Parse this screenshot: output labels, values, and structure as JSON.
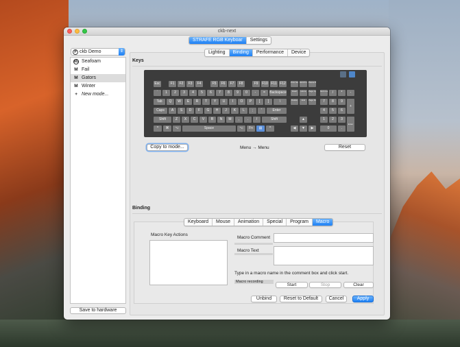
{
  "window": {
    "title": "ckb-next"
  },
  "top_tabs": [
    {
      "label": "STRAFE RGB  Keyboar",
      "active": true
    },
    {
      "label": "Settings",
      "active": false
    }
  ],
  "profile": {
    "icon_letter": "P",
    "name": "ckb Demo"
  },
  "modes": [
    {
      "icon": "M1",
      "label": "Seafoam"
    },
    {
      "icon": "M",
      "label": "Fail"
    },
    {
      "icon": "M",
      "label": "Gators"
    },
    {
      "icon": "M",
      "label": "Winter"
    },
    {
      "icon": "+",
      "label": "New mode..."
    }
  ],
  "save_hardware_label": "Save to hardware",
  "sub_tabs": [
    {
      "label": "Lighting"
    },
    {
      "label": "Binding"
    },
    {
      "label": "Performance"
    },
    {
      "label": "Device"
    }
  ],
  "keys_title": "Keys",
  "keyboard": {
    "fn_row": [
      "Esc",
      "F1",
      "F2",
      "F3",
      "F4",
      "F5",
      "F6",
      "F7",
      "F8",
      "F9",
      "F10",
      "F11",
      "F12"
    ],
    "fn_extra": [
      "Print Screen",
      "Scroll Lock",
      "Pause Break"
    ],
    "num_row": [
      "`",
      "1",
      "2",
      "3",
      "4",
      "5",
      "6",
      "7",
      "8",
      "9",
      "0",
      "-",
      "=",
      "Backspace"
    ],
    "nav_row1": [
      "Insert",
      "Home",
      "Page Up"
    ],
    "numpad_row1": [
      "Num Lock",
      "/",
      "*",
      "-"
    ],
    "q_row": [
      "Tab",
      "Q",
      "W",
      "E",
      "R",
      "T",
      "Y",
      "U",
      "I",
      "O",
      "P",
      "[",
      "]",
      "\\"
    ],
    "nav_row2": [
      "Delete",
      "End",
      "Page Down"
    ],
    "numpad_row2": [
      "7",
      "8",
      "9",
      "+"
    ],
    "a_row": [
      "Caps",
      "A",
      "S",
      "D",
      "F",
      "G",
      "H",
      "J",
      "K",
      "L",
      ";",
      "'",
      "Enter"
    ],
    "numpad_row3": [
      "4",
      "5",
      "6"
    ],
    "z_row": [
      "Shift",
      "Z",
      "X",
      "C",
      "V",
      "B",
      "N",
      "M",
      ",",
      ".",
      "/",
      "Shift"
    ],
    "arrow_up": "▲",
    "numpad_row4": [
      "1",
      "2",
      "3",
      "Enter"
    ],
    "bottom_row": [
      "^",
      "⌘",
      "⌥",
      "Space",
      "⌥",
      "Fn",
      "▤",
      "^"
    ],
    "arrows": [
      "◀",
      "▼",
      "▶"
    ],
    "numpad_row5": [
      "0",
      "."
    ]
  },
  "copy_to_mode_label": "Copy to mode...",
  "mapping_text": "Menu → Menu",
  "reset_label": "Reset",
  "binding_title": "Binding",
  "binding_tabs": [
    {
      "label": "Keyboard"
    },
    {
      "label": "Mouse"
    },
    {
      "label": "Animation"
    },
    {
      "label": "Special"
    },
    {
      "label": "Program"
    },
    {
      "label": "Macro",
      "active": true
    }
  ],
  "macro": {
    "key_actions_label": "Macro Key Actions",
    "comment_label": "Macro Comment",
    "text_label": "Macro Text",
    "hint": "Type in a macro name in the comment box and click start.",
    "recording_label": "Macro recording",
    "start_label": "Start",
    "stop_label": "Stop",
    "clear_label": "Clear"
  },
  "footer": {
    "unbind_label": "Unbind",
    "reset_default_label": "Reset to Default",
    "cancel_label": "Cancel",
    "apply_label": "Apply"
  },
  "colors": {
    "accent": "#1d80f5",
    "key": "#7b7b7b",
    "keyboard_bg": "#3c3c3c"
  }
}
